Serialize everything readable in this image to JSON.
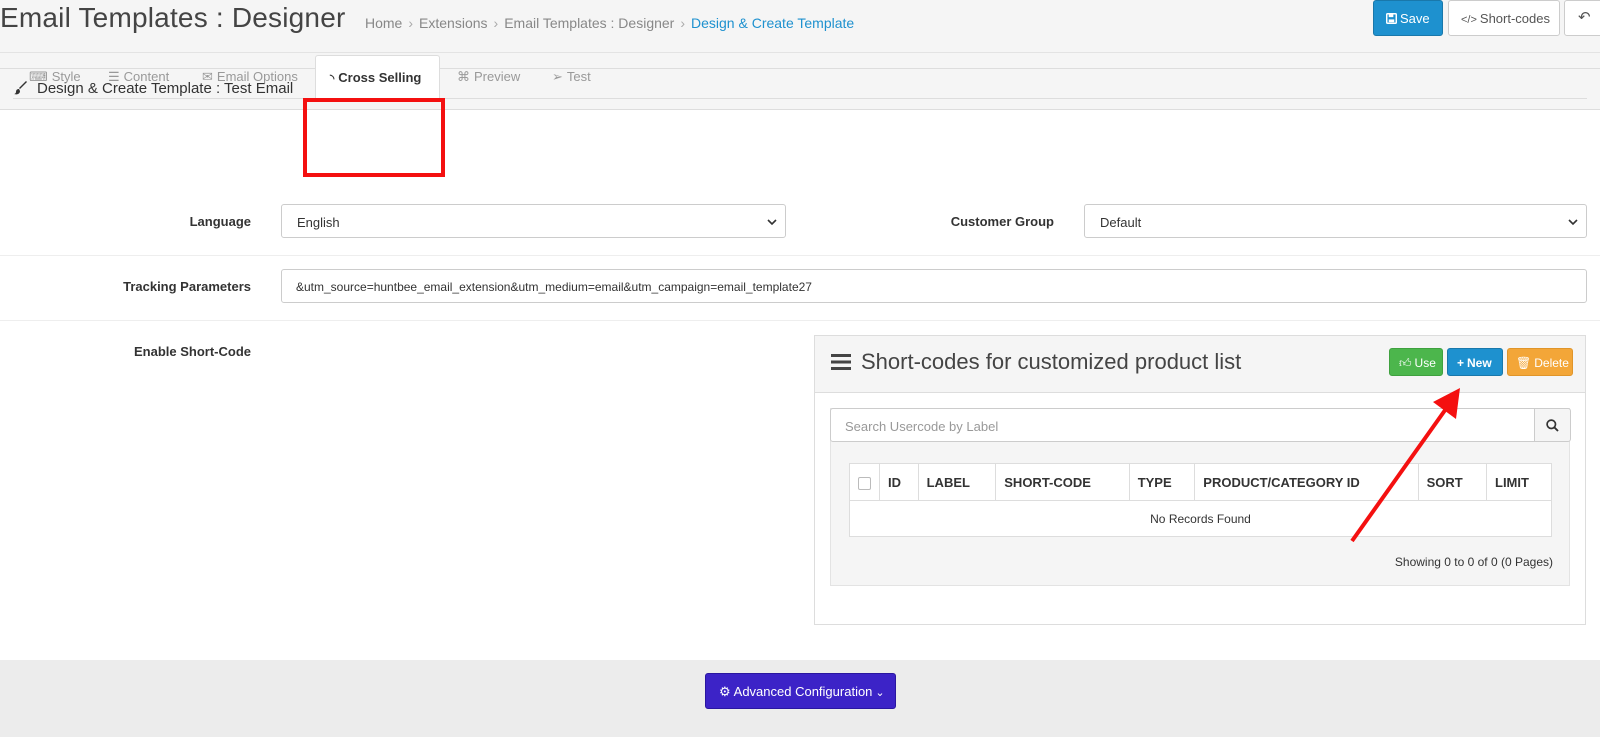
{
  "header": {
    "title": "Email Templates : Designer",
    "breadcrumb": [
      "Home",
      "Extensions",
      "Email Templates : Designer",
      "Design & Create Template"
    ],
    "save_label": "Save",
    "shortcodes_label": "Short-codes",
    "back_icon": "reply-icon"
  },
  "panel": {
    "title": "Design & Create Template : Test Email",
    "tabs": [
      "Style",
      "Content",
      "Email Options",
      "Cross Selling",
      "Preview",
      "Test"
    ],
    "active_tab": "Cross Selling"
  },
  "form": {
    "language_label": "Language",
    "language_value": "English",
    "customer_group_label": "Customer Group",
    "customer_group_value": "Default",
    "tracking_label": "Tracking Parameters",
    "tracking_value": "&utm_source=huntbee_email_extension&utm_medium=email&utm_campaign=email_template27",
    "shortcode_label": "Enable Short-Code"
  },
  "shortcodes_panel": {
    "title": "Short-codes for customized product list",
    "use_label": "Use",
    "new_label": "New",
    "delete_label": "Delete",
    "search_placeholder": "Search Usercode by Label",
    "columns": [
      "ID",
      "LABEL",
      "SHORT-CODE",
      "TYPE",
      "PRODUCT/CATEGORY ID",
      "SORT",
      "LIMIT"
    ],
    "empty_text": "No Records Found",
    "pagination": "Showing 0 to 0 of 0 (0 Pages)"
  },
  "footer": {
    "advanced_label": "Advanced Configuration"
  },
  "colors": {
    "primary": "#1e91cf",
    "success": "#4cb64c",
    "warning": "#f3a638",
    "advanced": "#3c23c7",
    "annotation": "#f41010"
  }
}
